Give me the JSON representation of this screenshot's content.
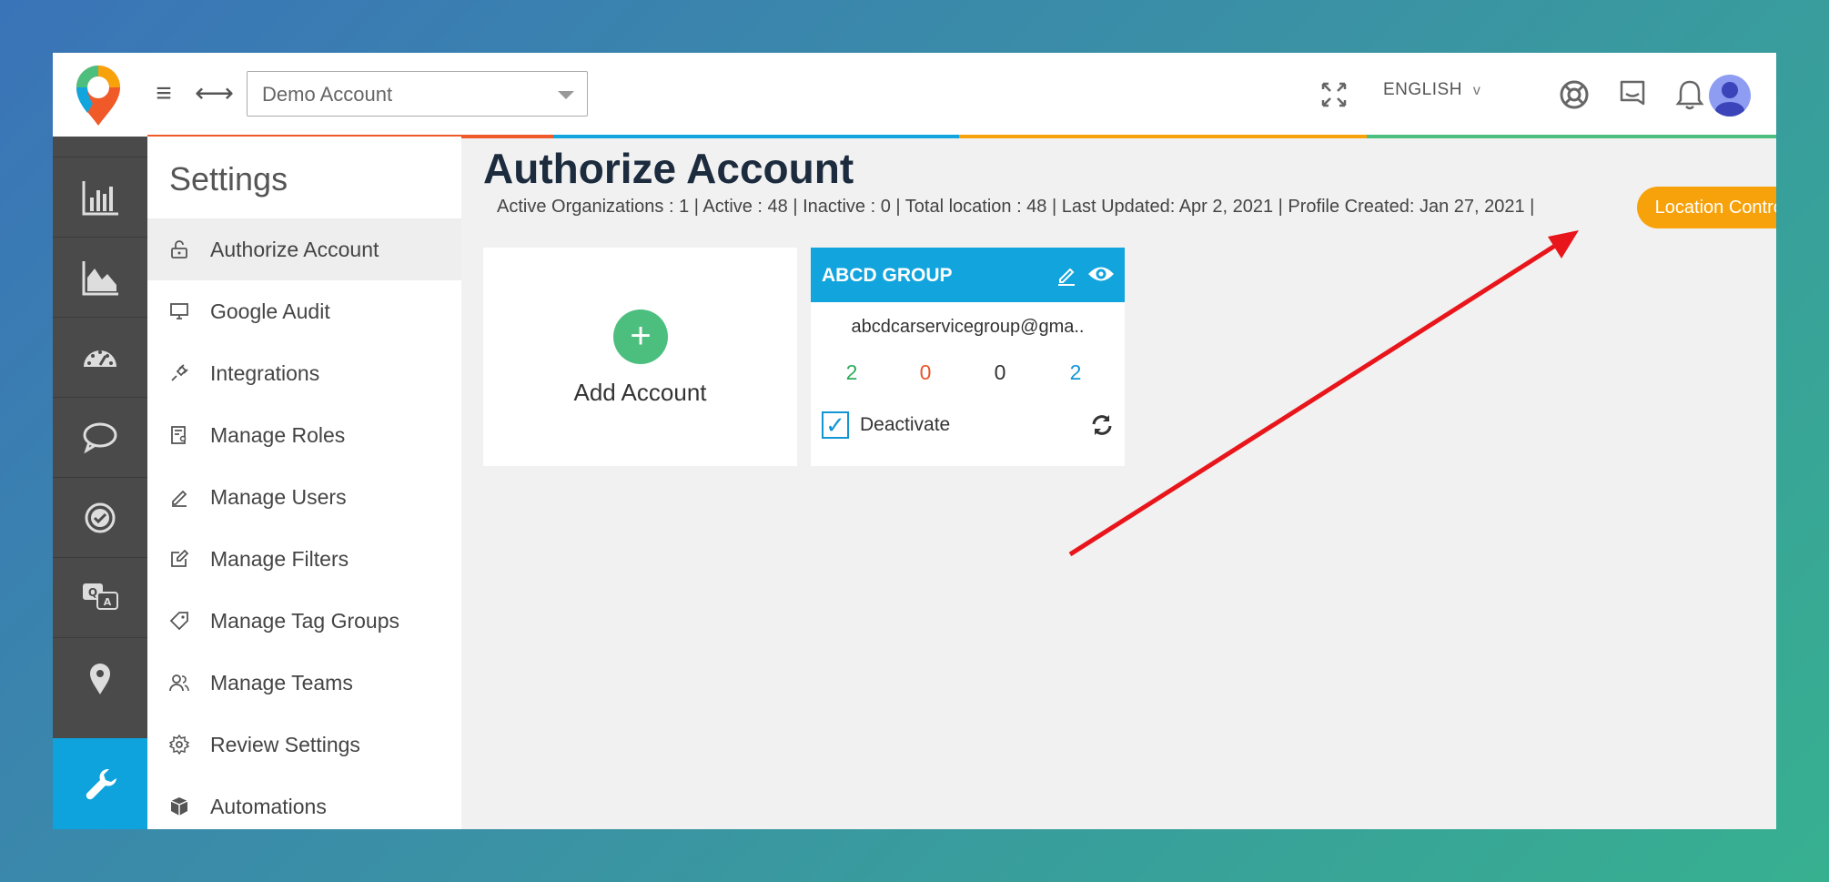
{
  "header": {
    "account_select_value": "Demo Account",
    "language": "ENGLISH",
    "language_caret": "v"
  },
  "settings": {
    "title": "Settings",
    "items": [
      {
        "label": "Authorize Account",
        "icon": "lock-icon"
      },
      {
        "label": "Google Audit",
        "icon": "monitor-icon"
      },
      {
        "label": "Integrations",
        "icon": "plug-icon"
      },
      {
        "label": "Manage Roles",
        "icon": "roles-icon"
      },
      {
        "label": "Manage Users",
        "icon": "pen-icon"
      },
      {
        "label": "Manage Filters",
        "icon": "edit-icon"
      },
      {
        "label": "Manage Tag Groups",
        "icon": "tag-icon"
      },
      {
        "label": "Manage Teams",
        "icon": "team-icon"
      },
      {
        "label": "Review Settings",
        "icon": "gear-icon"
      },
      {
        "label": "Automations",
        "icon": "box-icon"
      }
    ]
  },
  "main": {
    "title": "Authorize Account",
    "stats": "Active Organizations : 1 | Active : 48 | Inactive : 0 | Total location : 48  |  Last Updated: Apr 2, 2021  |  Profile Created: Jan 27, 2021  |",
    "location_controls_label": "Location Controls",
    "add_account": {
      "plus": "+",
      "label": "Add Account"
    },
    "org": {
      "name": "ABCD GROUP",
      "email": "abcdcarservicegroup@gma..",
      "counts": [
        "2",
        "0",
        "0",
        "2"
      ],
      "deactivate_label": "Deactivate",
      "deactivate_checked_mark": "✓"
    }
  },
  "colors": {
    "accent_blue": "#0ea3dc",
    "orange": "#f7a20b",
    "green": "#4cbf7f",
    "count_green": "#2eaa5c",
    "count_red": "#e8562a",
    "count_dark": "#333333",
    "count_blue": "#1296d3",
    "annotation_arrow": "#e8151b"
  }
}
